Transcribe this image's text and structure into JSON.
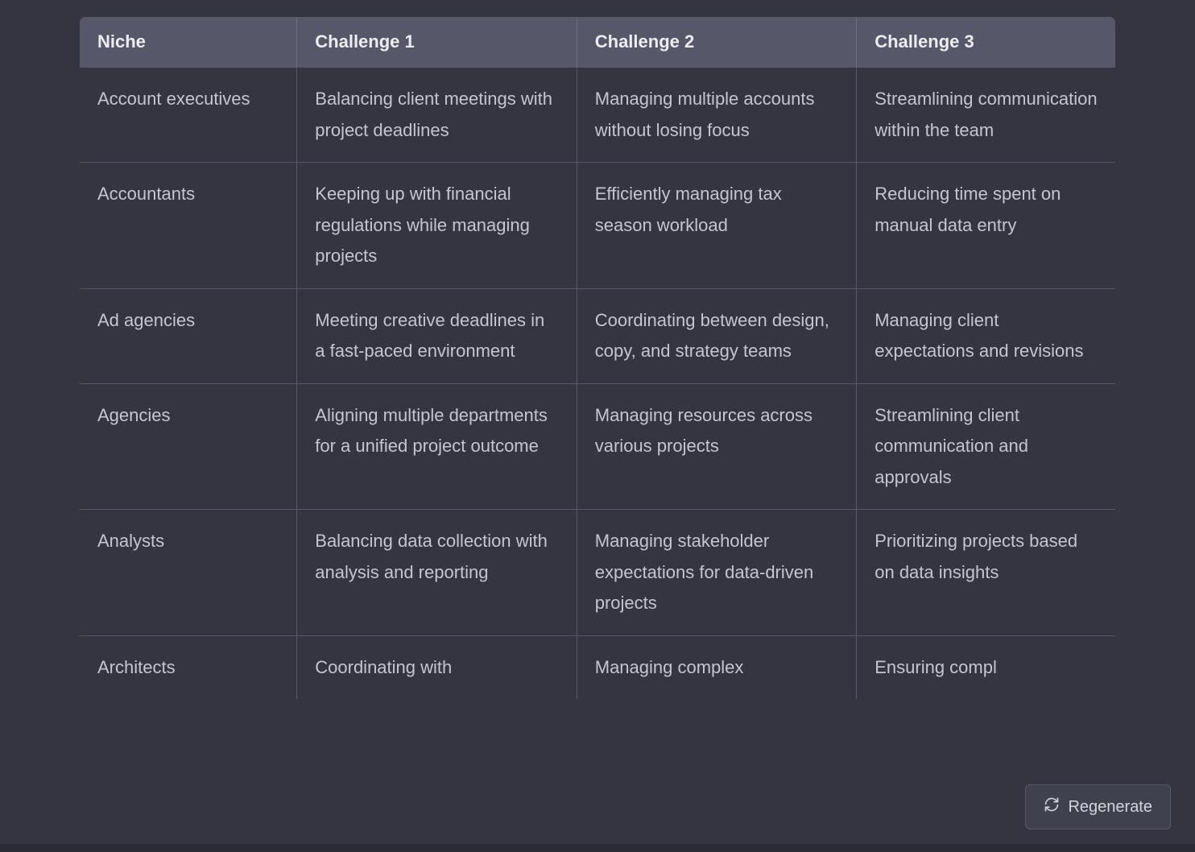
{
  "table": {
    "headers": [
      "Niche",
      "Challenge 1",
      "Challenge 2",
      "Challenge 3"
    ],
    "rows": [
      {
        "niche": "Account executives",
        "c1": "Balancing client meetings with project deadlines",
        "c2": "Managing multiple accounts without losing focus",
        "c3": "Streamlining communication within the team"
      },
      {
        "niche": "Accountants",
        "c1": "Keeping up with financial regulations while managing projects",
        "c2": "Efficiently managing tax season workload",
        "c3": "Reducing time spent on manual data entry"
      },
      {
        "niche": "Ad agencies",
        "c1": "Meeting creative deadlines in a fast-paced environment",
        "c2": "Coordinating between design, copy, and strategy teams",
        "c3": "Managing client expectations and revisions"
      },
      {
        "niche": "Agencies",
        "c1": "Aligning multiple departments for a unified project outcome",
        "c2": "Managing resources across various projects",
        "c3": "Streamlining client communication and approvals"
      },
      {
        "niche": "Analysts",
        "c1": "Balancing data collection with analysis and reporting",
        "c2": "Managing stakeholder expectations for data-driven projects",
        "c3": "Prioritizing projects based on data insights"
      },
      {
        "niche": "Architects",
        "c1": "Coordinating with",
        "c2": "Managing complex",
        "c3": "Ensuring compl"
      }
    ]
  },
  "actions": {
    "regenerate_label": "Regenerate"
  }
}
